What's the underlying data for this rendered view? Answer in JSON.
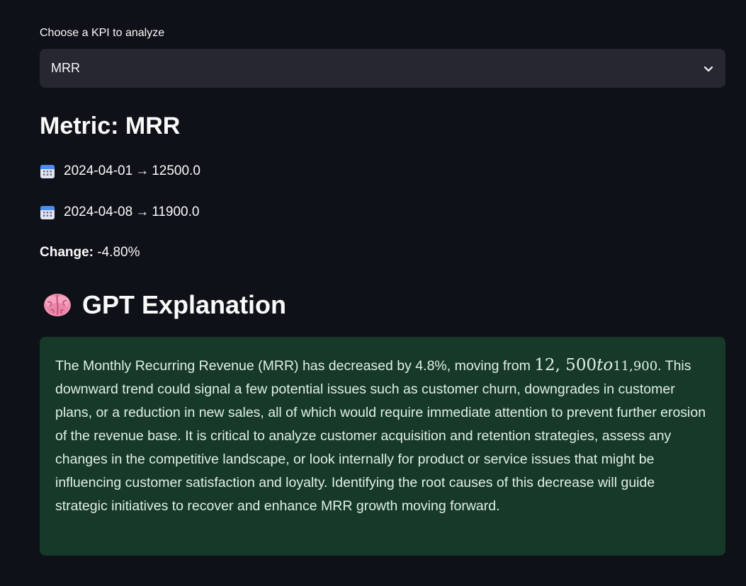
{
  "kpi_select": {
    "label": "Choose a KPI to analyze",
    "value": "MRR"
  },
  "metric": {
    "title": "Metric: MRR",
    "rows": [
      {
        "date": "2024-04-01",
        "arrow": "→",
        "value": "12500.0"
      },
      {
        "date": "2024-04-08",
        "arrow": "→",
        "value": "11900.0"
      }
    ],
    "change_label": "Change:",
    "change_value": "-4.80%"
  },
  "gpt": {
    "title": "GPT Explanation",
    "text_before": "The Monthly Recurring Revenue (MRR) has decreased by 4.8%, moving from ",
    "math_num": "12, 500",
    "math_word": "to",
    "math_tail": "11,900",
    "text_after": ". This downward trend could signal a few potential issues such as customer churn, downgrades in customer plans, or a reduction in new sales, all of which would require immediate attention to prevent further erosion of the revenue base. It is critical to analyze customer acquisition and retention strategies, assess any changes in the competitive landscape, or look internally for product or service issues that might be influencing customer satisfaction and loyalty. Identifying the root causes of this decrease will guide strategic initiatives to recover and enhance MRR growth moving forward."
  },
  "colors": {
    "background": "#0e1117",
    "select_bg": "#262730",
    "success_bg": "#173928",
    "success_text": "#dff0e4"
  },
  "icons": [
    "chevron-down-icon",
    "calendar-icon",
    "brain-icon"
  ]
}
